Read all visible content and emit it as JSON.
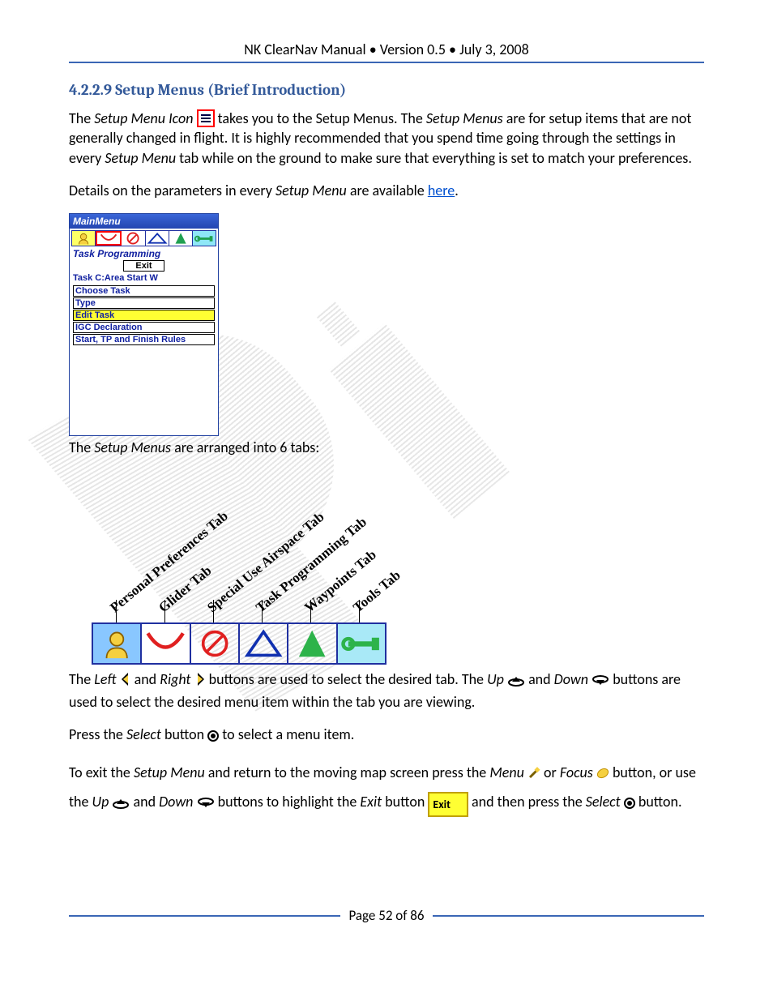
{
  "header": "NK ClearNav Manual  •  Version 0.5  •  July 3, 2008",
  "section": {
    "number_title": "4.2.2.9   Setup Menus (Brief Introduction)",
    "p1_a": "The ",
    "p1_b": "Setup Menu Icon",
    "p1_c": " takes you to the Setup Menus.   The ",
    "p1_d": "Setup Menus",
    "p1_e": " are for setup items that are not generally changed in flight.   It is highly recommended that you spend time going through the settings in every ",
    "p1_f": "Setup Menu",
    "p1_g": " tab while on the ground to make sure that everything is set to match your preferences.",
    "p2_a": "Details on the parameters in every ",
    "p2_b": "Setup Menu",
    "p2_c": " are available ",
    "p2_link": "here",
    "p2_d": "."
  },
  "menu_panel": {
    "title": "MainMenu",
    "section_title": "Task Programming",
    "exit": "Exit",
    "task_line": "Task C:Area Start W",
    "items": [
      "Choose Task",
      "Type",
      "Edit Task",
      "IGC Declaration",
      "Start, TP and Finish Rules"
    ],
    "highlight_index": 2
  },
  "after_panel": {
    "a": "The ",
    "b": "Setup Menus",
    "c": " are arranged into 6 tabs:"
  },
  "tabs_diagram": {
    "labels": [
      "Personal Preferences Tab",
      "Glider Tab",
      "Special Use Airspace Tab",
      "Task Programming Tab",
      "Waypoints Tab",
      "Tools Tab"
    ]
  },
  "p_nav": {
    "a": "The ",
    "left": "Left",
    "b": " and ",
    "right": "Right",
    "c": " buttons are used to select the desired tab.   The ",
    "up": "Up",
    "d": " and ",
    "down": "Down",
    "e": " buttons are used to select the desired menu item within the tab you are viewing."
  },
  "p_select": {
    "a": "Press the ",
    "select": "Select",
    "b": " button ",
    "c": " to select a menu item."
  },
  "p_exit": {
    "a": "To exit the ",
    "setup": "Setup Menu",
    "b": " and return to the moving map screen press the ",
    "menu": "Menu",
    "c": " or ",
    "focus": "Focus",
    "d": " button, or use the ",
    "up": "Up",
    "e": " and ",
    "down": "Down",
    "f": " buttons to highlight the ",
    "exit_i": "Exit",
    "g": " button   ",
    "exit_btn": "Exit",
    "h": " and then press the ",
    "select": "Select",
    "i": " button."
  },
  "footer": "Page 52 of 86"
}
